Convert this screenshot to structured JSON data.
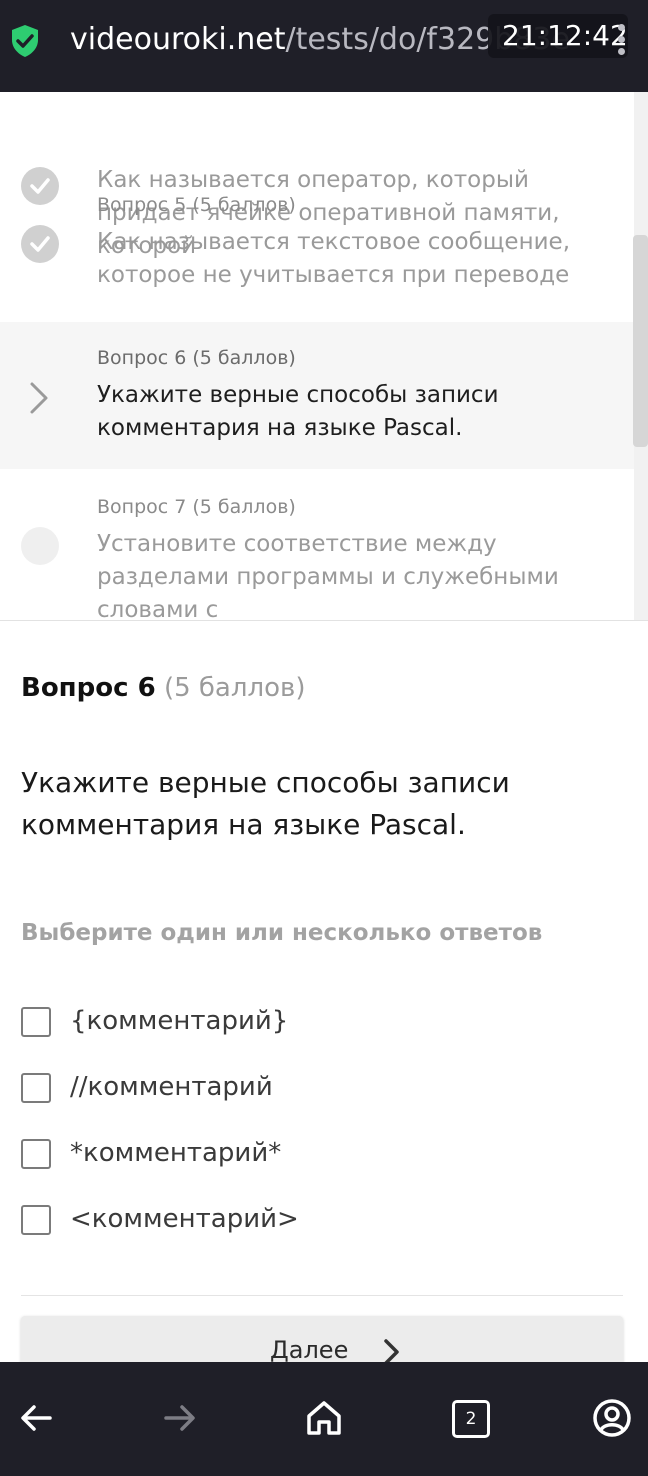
{
  "browser": {
    "url_domain": "videouroki.net",
    "url_path": "/tests/do/f329b83e",
    "clock": "21:12:42",
    "tab_count": "2"
  },
  "questions": [
    {
      "meta": "",
      "text": "Как называется оператор, который придает ячейке оперативной памяти, которой",
      "state": "done"
    },
    {
      "meta": "Вопрос 5 (5 баллов)",
      "text": "Как называется текстовое сообщение, которое не учитывается при переводе",
      "state": "done"
    },
    {
      "meta": "Вопрос 6 (5 баллов)",
      "text": "Укажите верные способы записи комментария на языке Pascal.",
      "state": "active"
    },
    {
      "meta": "Вопрос 7 (5 баллов)",
      "text": "Установите соответствие между разделами программы и служебными словами с",
      "state": "pending"
    }
  ],
  "current": {
    "title": "Вопрос 6",
    "points": "(5 баллов)",
    "body": "Укажите верные способы записи комментария на языке Pascal.",
    "hint": "Выберите один или несколько ответов",
    "options": [
      "{комментарий}",
      "//комментарий",
      "*комментарий*",
      "<комментарий>"
    ],
    "next_label": "Далее"
  },
  "colors": {
    "bar_bg": "#1f1f28",
    "shield_green": "#2ecc71",
    "active_row_bg": "#f6f6f6"
  }
}
